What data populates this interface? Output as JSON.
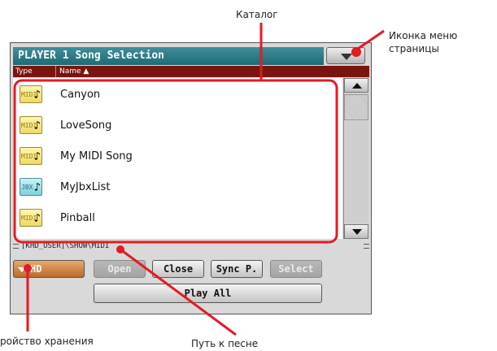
{
  "annotations": {
    "catalog": "Каталог",
    "menu_icon": "Иконка меню страницы",
    "storage": "ройство хранения",
    "song_path": "Путь к песне"
  },
  "window": {
    "title": "PLAYER 1 Song Selection",
    "menu_icon": "chevron-down-icon"
  },
  "columns": {
    "type": "Type",
    "name": "Name ▲"
  },
  "files": [
    {
      "name": "Canyon",
      "type_label": "MIDI",
      "icon": "midi-file-icon"
    },
    {
      "name": "LoveSong",
      "type_label": "MIDI",
      "icon": "midi-file-icon"
    },
    {
      "name": "My MIDI Song",
      "type_label": "MIDI",
      "icon": "midi-file-icon"
    },
    {
      "name": "MyJbxList",
      "type_label": "JBX",
      "icon": "jukebox-file-icon"
    },
    {
      "name": "Pinball",
      "type_label": "MIDI",
      "icon": "midi-file-icon"
    }
  ],
  "path": "[KHD_USER]\\SHOW\\MIDI",
  "buttons": {
    "device": "HD",
    "open": "Open",
    "close": "Close",
    "sync": "Sync P.",
    "select": "Select",
    "play_all": "Play All"
  },
  "colors": {
    "title_bar": "#2a7a85",
    "column_header": "#7a1410",
    "highlight": "#e31b23",
    "device_button": "#c7793a"
  }
}
